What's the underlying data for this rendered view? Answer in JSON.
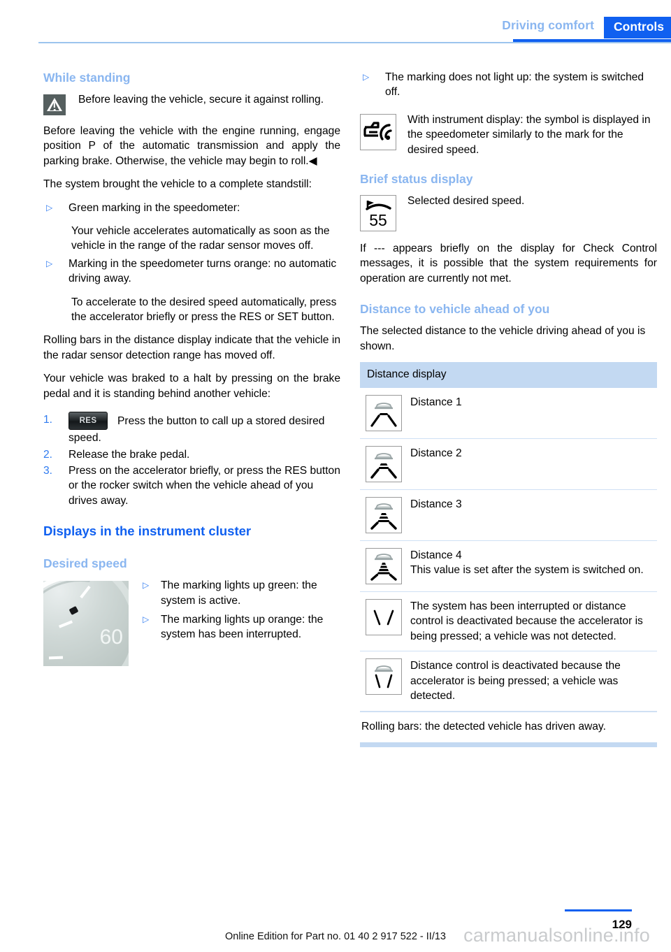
{
  "header": {
    "chapter": "Driving comfort",
    "section": "Controls"
  },
  "left_column": {
    "heading_while_standing": "While standing",
    "warning": {
      "icon": "warning-triangle-icon",
      "text": "Before leaving the vehicle, secure it against rolling."
    },
    "para_before_leaving": "Before leaving the vehicle with the engine running, engage position P of the automatic transmission and apply the parking brake. Otherwise, the vehicle may begin to roll.◀",
    "para_standstill": "The system brought the vehicle to a complete standstill:",
    "bullets": [
      {
        "mark": "▷",
        "text": "Green marking in the speedometer:",
        "sub": "Your vehicle accelerates automatically as soon as the vehicle in the range of the radar sensor moves off."
      },
      {
        "mark": "▷",
        "text": "Marking in the speedometer turns orange: no automatic driving away.",
        "sub": "To accelerate to the desired speed automatically, press the accelerator briefly or press the RES or SET button."
      }
    ],
    "para_rolling_bars": "Rolling bars in the distance display indicate that the vehicle in the radar sensor detection range has moved off.",
    "para_braked": "Your vehicle was braked to a halt by pressing on the brake pedal and it is standing behind another vehicle:",
    "steps": [
      {
        "mark": "1.",
        "button_label": "RES",
        "text": "Press the button to call up a stored desired speed."
      },
      {
        "mark": "2.",
        "text": "Release the brake pedal."
      },
      {
        "mark": "3.",
        "text": "Press on the accelerator briefly, or press the RES button or the rocker switch when the vehicle ahead of you drives away."
      }
    ],
    "heading_displays": "Displays in the instrument cluster",
    "heading_desired_speed": "Desired speed",
    "speedometer": {
      "icon": "speedometer-image",
      "value_label": "60"
    },
    "speed_bullets": [
      {
        "mark": "▷",
        "text": "The marking lights up green: the system is active."
      },
      {
        "mark": "▷",
        "text": "The marking lights up orange: the system has been interrupted."
      }
    ]
  },
  "right_column": {
    "bullet_not_light": {
      "mark": "▷",
      "text": "The marking does not light up: the system is switched off."
    },
    "instrument_symbol": {
      "icon": "car-distance-symbol-icon",
      "text": "With instrument display: the symbol is displayed in the speedometer similarly to the mark for the desired speed."
    },
    "heading_brief_status": "Brief status display",
    "brief_status": {
      "icon": "desired-speed-55-icon",
      "icon_value": "55",
      "text": "Selected desired speed."
    },
    "para_dashes": "If --- appears briefly on the display for Check Control messages, it is possible that the system requirements for operation are currently not met.",
    "heading_distance": "Distance to vehicle ahead of you",
    "para_distance_intro": "The selected distance to the vehicle driving ahead of you is shown.",
    "table": {
      "header": "Distance display",
      "rows": [
        {
          "icon": "distance-1-icon",
          "bars": 0,
          "car": true,
          "lanes": "solid",
          "text": "Distance 1",
          "text2": ""
        },
        {
          "icon": "distance-2-icon",
          "bars": 2,
          "car": true,
          "lanes": "solid",
          "text": "Distance 2",
          "text2": ""
        },
        {
          "icon": "distance-3-icon",
          "bars": 3,
          "car": true,
          "lanes": "solid",
          "text": "Distance 3",
          "text2": ""
        },
        {
          "icon": "distance-4-icon",
          "bars": 4,
          "car": true,
          "lanes": "solid",
          "text": "Distance 4",
          "text2": "This value is set after the system is switched on."
        },
        {
          "icon": "distance-interrupted-icon",
          "bars": 0,
          "car": false,
          "lanes": "open",
          "text": "The system has been interrupted or distance control is deactivated because the accelerator is being pressed; a vehicle was not detected.",
          "text2": ""
        },
        {
          "icon": "distance-deactivated-icon",
          "bars": 0,
          "car": true,
          "lanes": "open",
          "text": "Distance control is deactivated because the accelerator is being pressed; a vehicle was detected.",
          "text2": ""
        }
      ],
      "footer": "Rolling bars: the detected vehicle has driven away."
    }
  },
  "footer": {
    "edition": "Online Edition for Part no. 01 40 2 917 522 - II/13",
    "page_number": "129",
    "watermark": "carmanualsonline.info"
  },
  "colors": {
    "accent_blue": "#1060f0",
    "light_blue": "#8ab6f0",
    "table_header": "#c3d9f2",
    "rule": "#9cc4ee"
  }
}
